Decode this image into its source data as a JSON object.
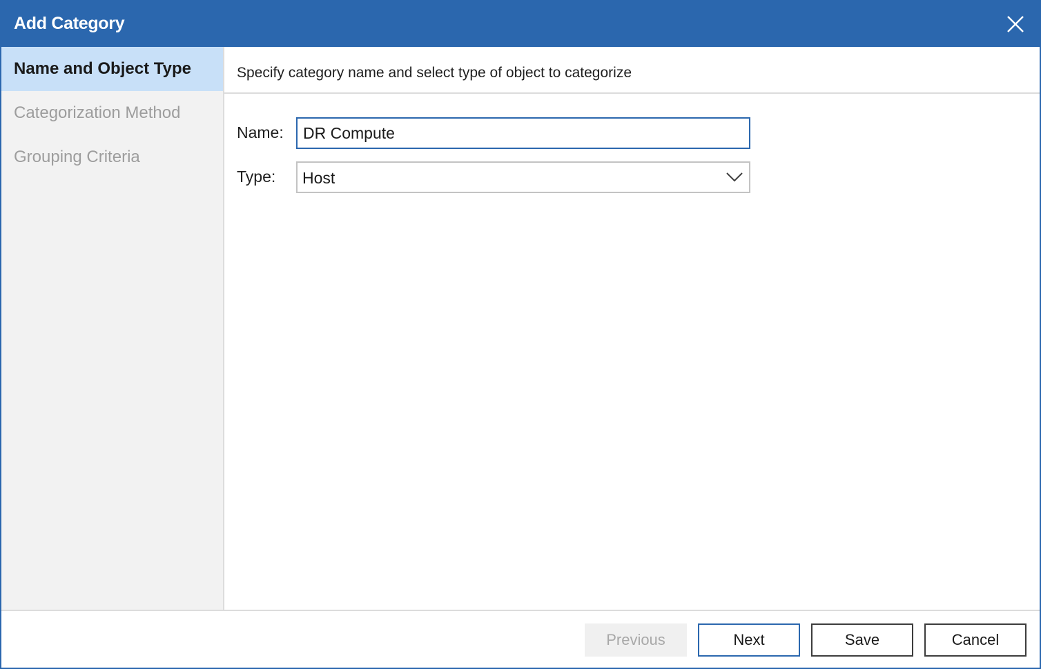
{
  "dialog": {
    "title": "Add Category",
    "accent_color": "#2b67ae"
  },
  "sidebar": {
    "items": [
      {
        "label": "Name and Object Type",
        "state": "active"
      },
      {
        "label": "Categorization Method",
        "state": "inactive"
      },
      {
        "label": "Grouping Criteria",
        "state": "inactive"
      }
    ]
  },
  "main": {
    "subtitle": "Specify category name and select type of object to categorize",
    "name_label": "Name:",
    "name_value": "DR Compute",
    "type_label": "Type:",
    "type_value": "Host"
  },
  "footer": {
    "previous_label": "Previous",
    "next_label": "Next",
    "save_label": "Save",
    "cancel_label": "Cancel"
  },
  "icons": {
    "close": "close-icon",
    "dropdown": "chevron-down-icon"
  }
}
